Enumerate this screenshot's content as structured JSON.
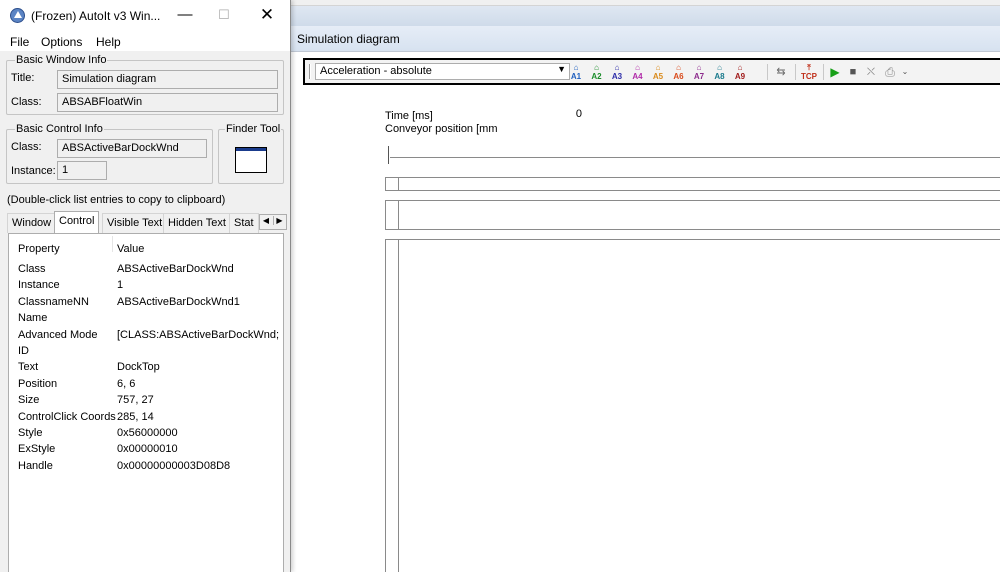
{
  "sim": {
    "title": "Simulation diagram",
    "toolbar": {
      "dropdown_value": "Acceleration - absolute",
      "axis_buttons": [
        "A1",
        "A2",
        "A3",
        "A4",
        "A5",
        "A6",
        "A7",
        "A8",
        "A9"
      ],
      "axis_colors": [
        "#1f5fbf",
        "#1a8c2a",
        "#2c2ca8",
        "#b02aa8",
        "#d98a1a",
        "#d94a1a",
        "#8c2a8c",
        "#1a7a8c",
        "#a01a1a"
      ],
      "tcp_label": "TCP"
    },
    "time_label": "Time [ms]",
    "conveyor_label": "Conveyor position [mm]",
    "time_value": "0"
  },
  "autoit": {
    "title": "(Frozen) AutoIt v3 Win...",
    "menu": [
      "File",
      "Options",
      "Help"
    ],
    "basic_window": {
      "group_title": "Basic Window Info",
      "title_label": "Title:",
      "title_value": "Simulation diagram",
      "class_label": "Class:",
      "class_value": "ABSABFloatWin"
    },
    "basic_control": {
      "group_title": "Basic Control Info",
      "class_label": "Class:",
      "class_value": "ABSActiveBarDockWnd",
      "instance_label": "Instance:",
      "instance_value": "1"
    },
    "finder_tool": "Finder Tool",
    "hint": "(Double-click list entries to copy to clipboard)",
    "tabs": [
      "Window",
      "Control",
      "Visible Text",
      "Hidden Text",
      "Stat"
    ],
    "active_tab": "Control",
    "list_headers": {
      "property": "Property",
      "value": "Value"
    },
    "rows": [
      {
        "property": "Class",
        "value": "ABSActiveBarDockWnd"
      },
      {
        "property": "Instance",
        "value": "1"
      },
      {
        "property": "ClassnameNN",
        "value": "ABSActiveBarDockWnd1"
      },
      {
        "property": "Name",
        "value": ""
      },
      {
        "property": "Advanced Mode",
        "value": "[CLASS:ABSActiveBarDockWnd; IN"
      },
      {
        "property": "ID",
        "value": ""
      },
      {
        "property": "Text",
        "value": "DockTop"
      },
      {
        "property": "Position",
        "value": "6, 6"
      },
      {
        "property": "Size",
        "value": "757, 27"
      },
      {
        "property": "ControlClick Coords",
        "value": "285, 14"
      },
      {
        "property": "Style",
        "value": "0x56000000"
      },
      {
        "property": "ExStyle",
        "value": "0x00000010"
      },
      {
        "property": "Handle",
        "value": "0x00000000003D08D8"
      }
    ]
  }
}
